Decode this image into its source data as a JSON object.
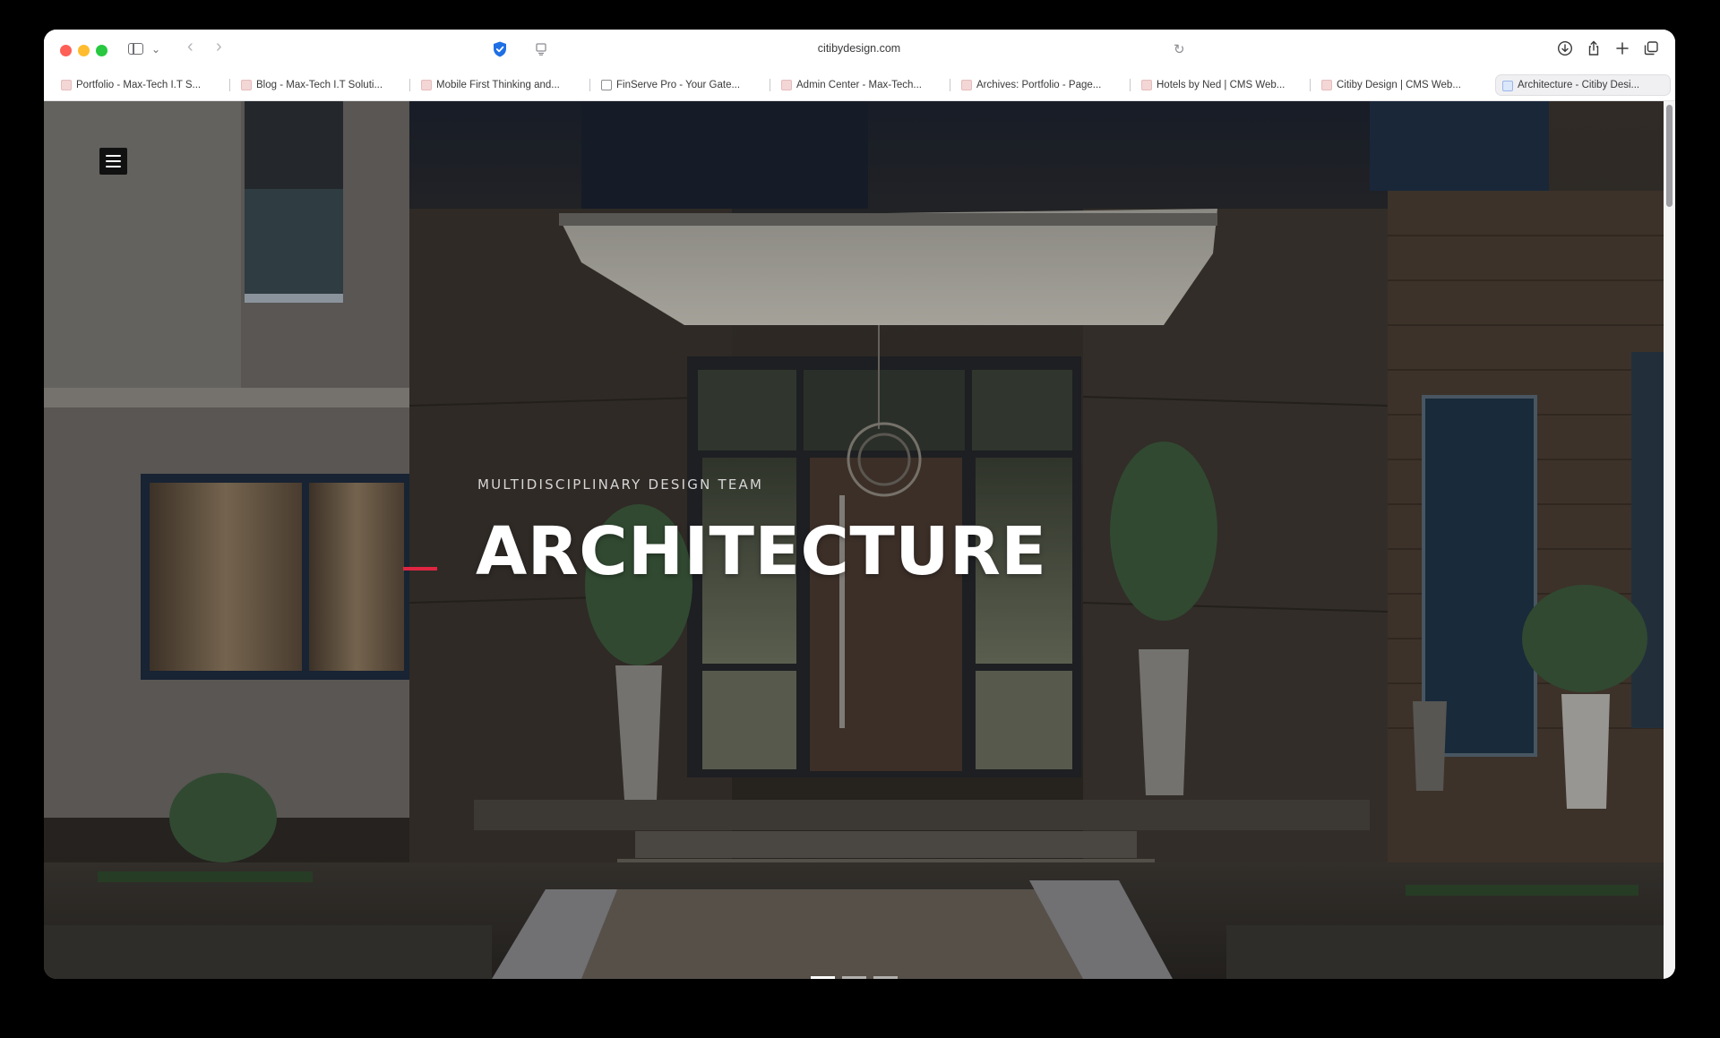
{
  "browser": {
    "url": "citibydesign.com",
    "tabs": [
      {
        "label": "Portfolio - Max-Tech I.T S...",
        "favicon": "maxtech-favicon",
        "active": false
      },
      {
        "label": "Blog - Max-Tech I.T Soluti...",
        "favicon": "maxtech-favicon",
        "active": false
      },
      {
        "label": "Mobile First Thinking and...",
        "favicon": "maxtech-favicon",
        "active": false
      },
      {
        "label": "FinServe Pro - Your Gate...",
        "favicon": "document-favicon",
        "active": false
      },
      {
        "label": "Admin Center - Max-Tech...",
        "favicon": "maxtech-favicon",
        "active": false
      },
      {
        "label": "Archives: Portfolio - Page...",
        "favicon": "maxtech-favicon",
        "active": false
      },
      {
        "label": "Hotels by Ned | CMS Web...",
        "favicon": "maxtech-favicon",
        "active": false
      },
      {
        "label": "Citiby Design | CMS Web...",
        "favicon": "maxtech-favicon",
        "active": false
      },
      {
        "label": "Architecture - Citiby Desi...",
        "favicon": "citiby-favicon",
        "active": true
      }
    ]
  },
  "hero": {
    "eyebrow": "MULTIDISCIPLINARY DESIGN TEAM",
    "title": "ARCHITECTURE",
    "accent_color": "#e02542",
    "slides": 3,
    "active_slide": 0
  },
  "icons": {
    "sidebar": "sidebar-toggle-icon",
    "tab_overview": "chevron-down-icon",
    "back": "back-arrow-icon",
    "forward": "forward-arrow-icon",
    "privacy": "shield-icon",
    "reader": "page-icon",
    "reload": "reload-icon",
    "downloads": "download-icon",
    "share": "share-icon",
    "new_tab": "plus-icon",
    "tab_overview_grid": "tabs-icon",
    "menu": "hamburger-icon"
  }
}
